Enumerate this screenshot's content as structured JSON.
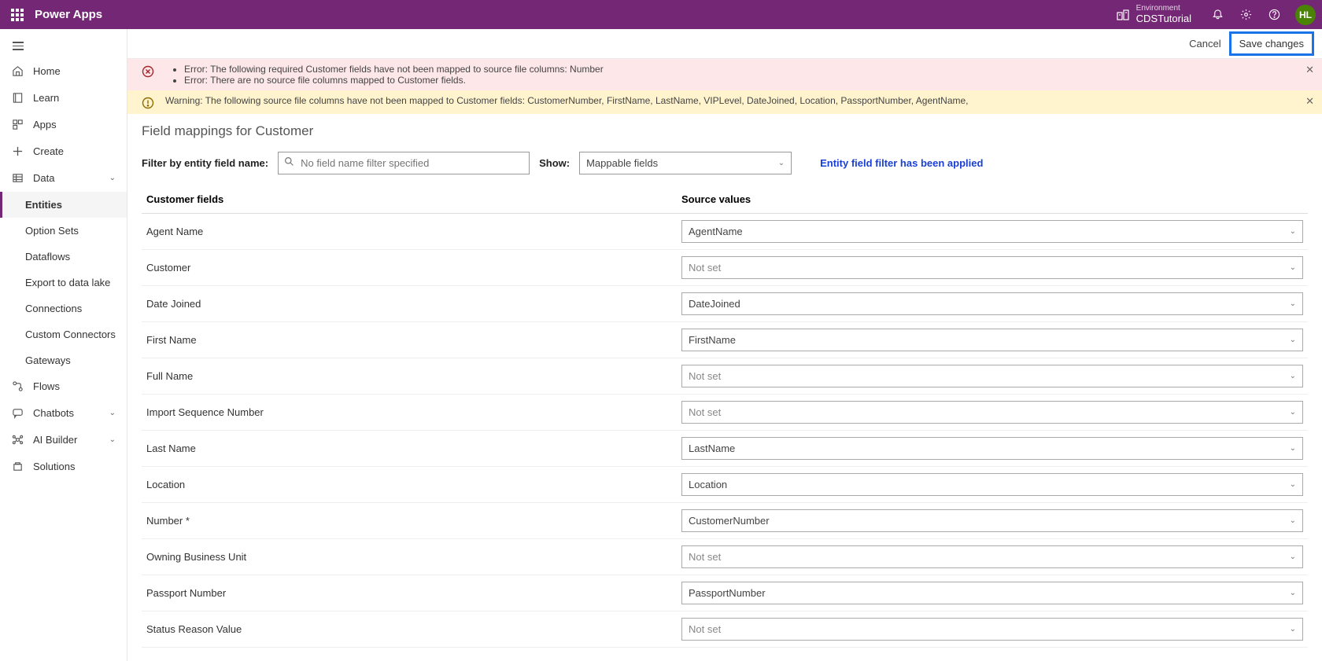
{
  "app_title": "Power Apps",
  "environment": {
    "label": "Environment",
    "name": "CDSTutorial"
  },
  "avatar_initials": "HL",
  "actions": {
    "cancel": "Cancel",
    "save": "Save changes"
  },
  "errors": [
    "Error: The following required Customer fields have not been mapped to source file columns: Number",
    "Error: There are no source file columns mapped to Customer fields."
  ],
  "warning": "Warning: The following source file columns have not been mapped to Customer fields: CustomerNumber, FirstName, LastName, VIPLevel, DateJoined, Location, PassportNumber, AgentName,",
  "sidebar": {
    "items": [
      {
        "label": "Home",
        "icon": "home"
      },
      {
        "label": "Learn",
        "icon": "book"
      },
      {
        "label": "Apps",
        "icon": "apps"
      },
      {
        "label": "Create",
        "icon": "plus"
      },
      {
        "label": "Data",
        "icon": "grid",
        "expand": true
      },
      {
        "label": "Entities",
        "sub": true,
        "selected": true
      },
      {
        "label": "Option Sets",
        "sub": true
      },
      {
        "label": "Dataflows",
        "sub": true
      },
      {
        "label": "Export to data lake",
        "sub": true
      },
      {
        "label": "Connections",
        "sub": true
      },
      {
        "label": "Custom Connectors",
        "sub": true
      },
      {
        "label": "Gateways",
        "sub": true
      },
      {
        "label": "Flows",
        "icon": "flow"
      },
      {
        "label": "Chatbots",
        "icon": "chat",
        "expand": true
      },
      {
        "label": "AI Builder",
        "icon": "ai",
        "expand": true
      },
      {
        "label": "Solutions",
        "icon": "solutions"
      }
    ]
  },
  "page": {
    "title": "Field mappings for Customer",
    "filter_label": "Filter by entity field name:",
    "filter_placeholder": "No field name filter specified",
    "show_label": "Show:",
    "show_value": "Mappable fields",
    "filter_note": "Entity field filter has been applied",
    "col_left": "Customer fields",
    "col_right": "Source values",
    "rows": [
      {
        "field": "Agent Name",
        "value": "AgentName"
      },
      {
        "field": "Customer",
        "value": "Not set",
        "notset": true
      },
      {
        "field": "Date Joined",
        "value": "DateJoined"
      },
      {
        "field": "First Name",
        "value": "FirstName"
      },
      {
        "field": "Full Name",
        "value": "Not set",
        "notset": true
      },
      {
        "field": "Import Sequence Number",
        "value": "Not set",
        "notset": true
      },
      {
        "field": "Last Name",
        "value": "LastName"
      },
      {
        "field": "Location",
        "value": "Location"
      },
      {
        "field": "Number *",
        "value": "CustomerNumber"
      },
      {
        "field": "Owning Business Unit",
        "value": "Not set",
        "notset": true
      },
      {
        "field": "Passport Number",
        "value": "PassportNumber"
      },
      {
        "field": "Status Reason Value",
        "value": "Not set",
        "notset": true
      }
    ]
  }
}
